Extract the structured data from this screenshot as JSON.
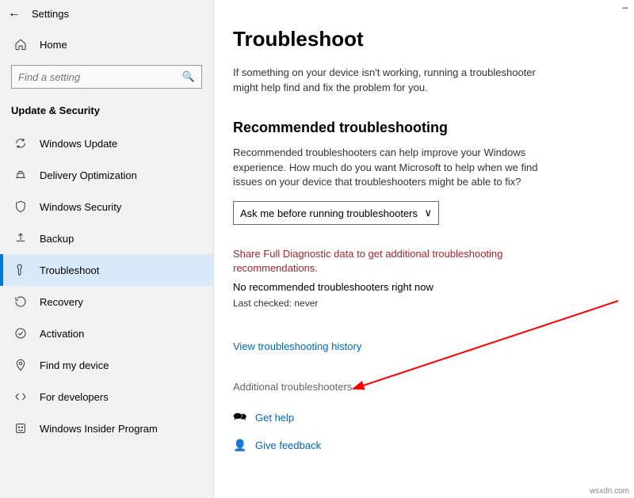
{
  "window": {
    "title": "Settings"
  },
  "home": {
    "label": "Home"
  },
  "search": {
    "placeholder": "Find a setting"
  },
  "category": {
    "label": "Update & Security"
  },
  "nav": {
    "items": [
      {
        "label": "Windows Update"
      },
      {
        "label": "Delivery Optimization"
      },
      {
        "label": "Windows Security"
      },
      {
        "label": "Backup"
      },
      {
        "label": "Troubleshoot"
      },
      {
        "label": "Recovery"
      },
      {
        "label": "Activation"
      },
      {
        "label": "Find my device"
      },
      {
        "label": "For developers"
      },
      {
        "label": "Windows Insider Program"
      }
    ]
  },
  "main": {
    "heading": "Troubleshoot",
    "intro": "If something on your device isn't working, running a troubleshooter might help find and fix the problem for you.",
    "recommended_heading": "Recommended troubleshooting",
    "recommended_desc": "Recommended troubleshooters can help improve your Windows experience. How much do you want Microsoft to help when we find issues on your device that troubleshooters might be able to fix?",
    "dropdown_value": "Ask me before running troubleshooters",
    "warning": "Share Full Diagnostic data to get additional troubleshooting recommendations.",
    "no_rec": "No recommended troubleshooters right now",
    "last_checked": "Last checked: never",
    "history_link": "View troubleshooting history",
    "additional_label": "Additional troubleshooters",
    "get_help": "Get help",
    "give_feedback": "Give feedback"
  },
  "watermark": "wsxdn.com"
}
